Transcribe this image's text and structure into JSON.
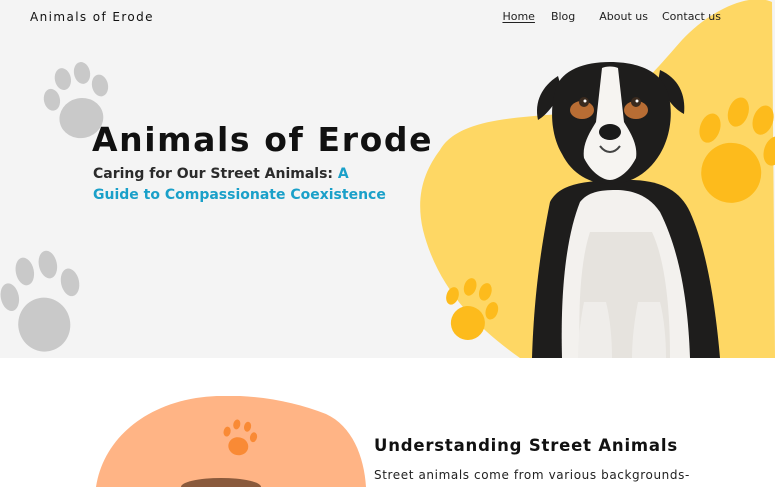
{
  "site": {
    "logo_text": "Animals of Erode"
  },
  "nav": {
    "items": [
      {
        "label": "Home",
        "active": true
      },
      {
        "label": "Blog",
        "active": false
      },
      {
        "label": "About us",
        "active": false
      },
      {
        "label": "Contact us",
        "active": false
      }
    ]
  },
  "hero": {
    "title": "Animals of Erode",
    "subtitle_part1": "Caring for Our Street Animals: ",
    "subtitle_accent": "A Guide to Compassionate Coexistence",
    "image_icon": "dog-photo"
  },
  "section": {
    "title": "Understanding Street Animals",
    "text": "Street animals come from various backgrounds-some are abandoned pets, while others are born"
  },
  "colors": {
    "hero_bg": "#f4f4f4",
    "yellow_blob": "#fed764",
    "yellow_paw": "#fdbb1c",
    "gray_paw": "#c9c9c9",
    "orange_blob": "#ffb485",
    "orange_paw": "#f98a35",
    "accent_text": "#1aa0c9"
  }
}
